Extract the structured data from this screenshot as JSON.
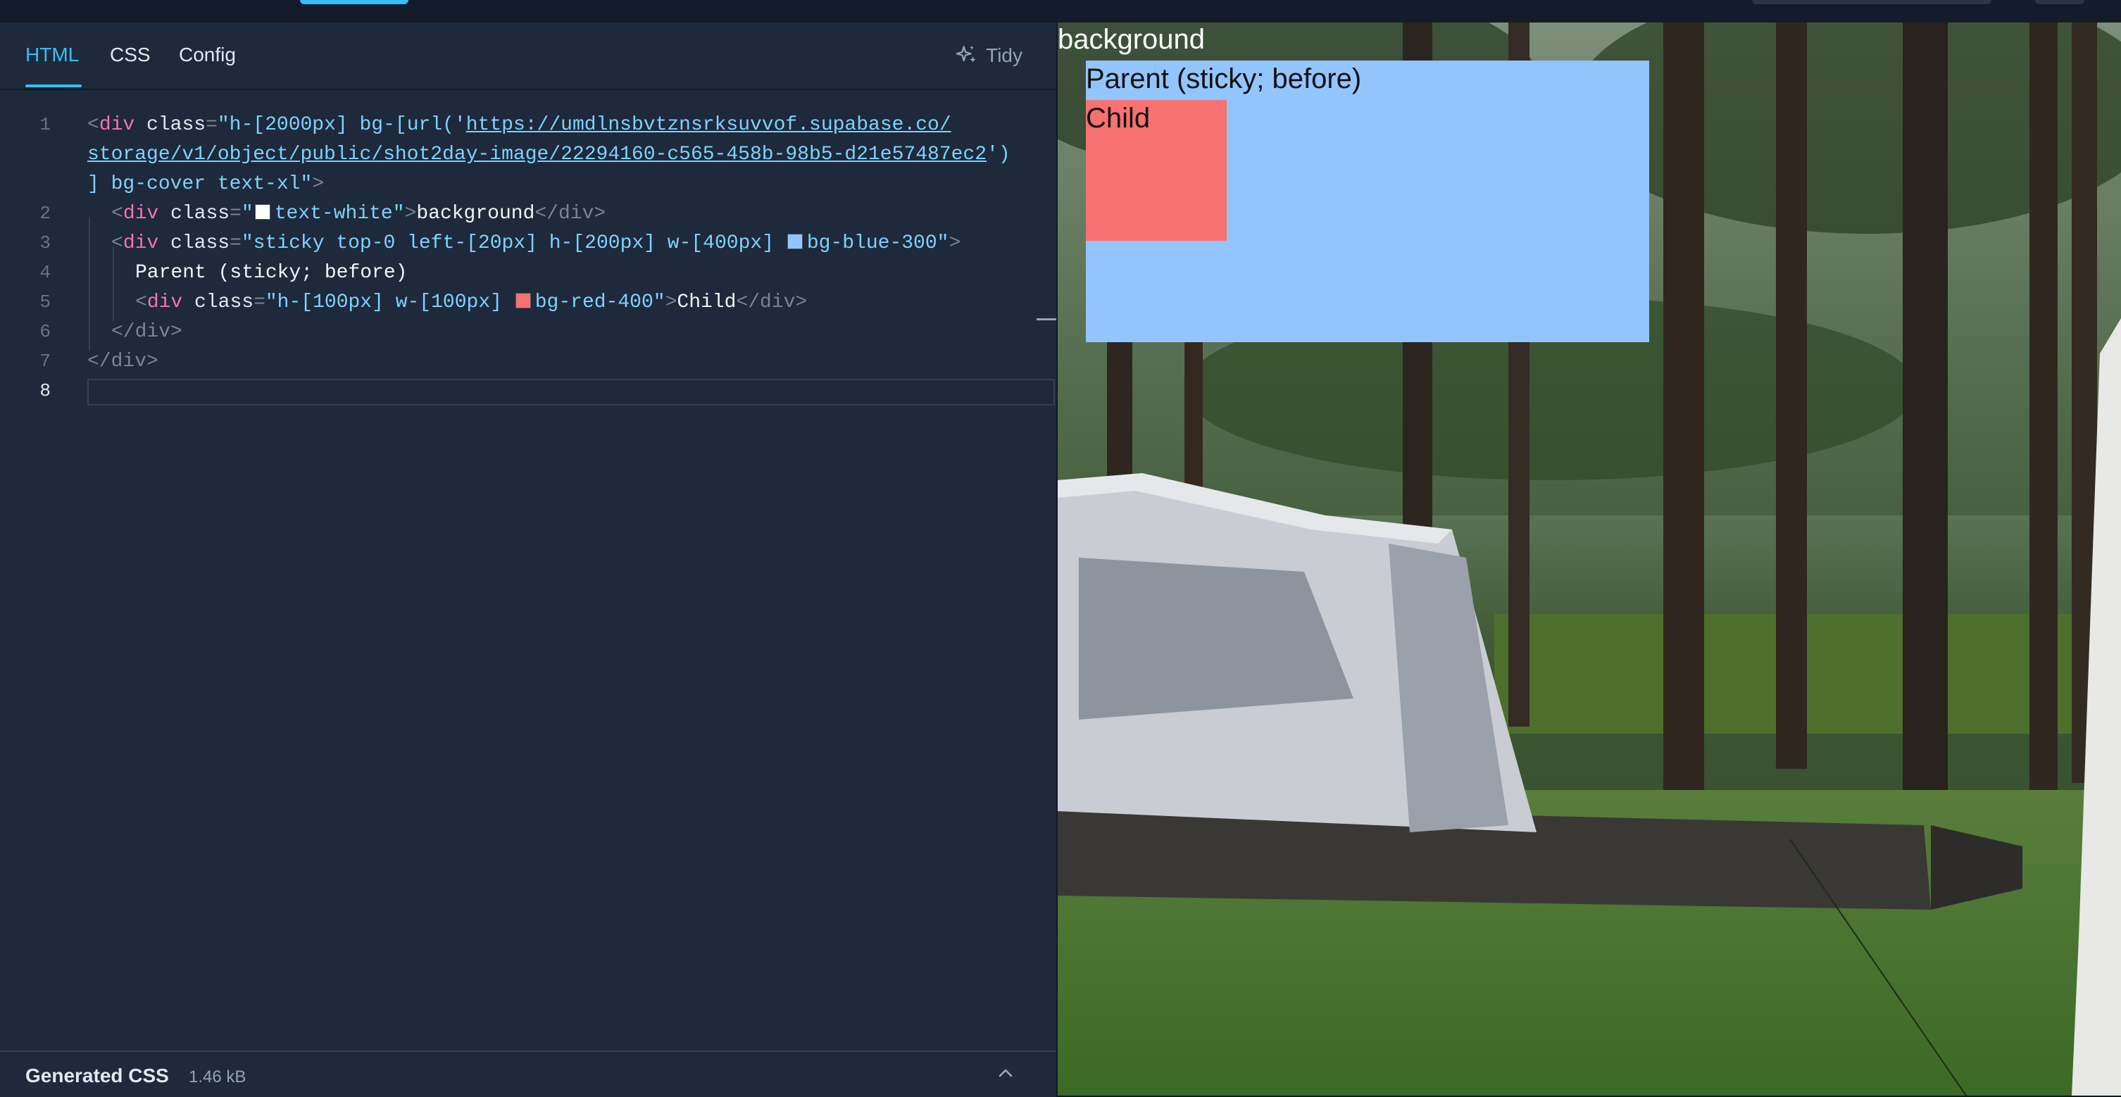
{
  "editor": {
    "tabs": [
      {
        "label": "HTML",
        "active": true
      },
      {
        "label": "CSS",
        "active": false
      },
      {
        "label": "Config",
        "active": false
      }
    ],
    "tidy_label": "Tidy",
    "line_numbers": [
      "1",
      "2",
      "3",
      "4",
      "5",
      "6",
      "7",
      "8"
    ],
    "code": {
      "l1_open": "<",
      "l1_tag": "div",
      "l1_attr": " class",
      "l1_eq": "=",
      "l1_str_a": "\"h-[2000px] bg-[url('",
      "l1_url_a": "https://umdlnsbvtznsrksuvvof.supabase.co/",
      "l1_url_b": "storage/v1/object/public/shot2day-image/22294160-c565-458b-98b5-d21e57487ec2",
      "l1_str_b": "')",
      "l1_str_c": "] bg-cover text-xl\"",
      "l1_close": ">",
      "l2_str_a": "\"",
      "l2_str_b": "text-white\"",
      "l2_text": "background",
      "l2_end": "</div>",
      "l3_str_a": "\"sticky top-0 left-[20px] h-[200px] w-[400px] ",
      "l3_str_b": "bg-blue-300\"",
      "l4_text": "Parent (sticky; before)",
      "l5_str_a": "\"h-[100px] w-[100px] ",
      "l5_str_b": "bg-red-400\"",
      "l5_text": "Child",
      "l5_end": "</div>",
      "l6_end": "</div>",
      "l7_end": "</div>"
    },
    "swatch_colors": {
      "white": "#ffffff",
      "blue": "#93c5fd",
      "red": "#f87171"
    },
    "generated": {
      "title": "Generated CSS",
      "size": "1.46 kB"
    }
  },
  "preview": {
    "background_text": "background",
    "parent_text": "Parent (sticky; before)",
    "child_text": "Child",
    "parent_color": "#93c5fd",
    "child_color": "#f87171"
  },
  "icons": {
    "tidy": "sparkles-icon",
    "collapse": "chevron-up-icon"
  }
}
